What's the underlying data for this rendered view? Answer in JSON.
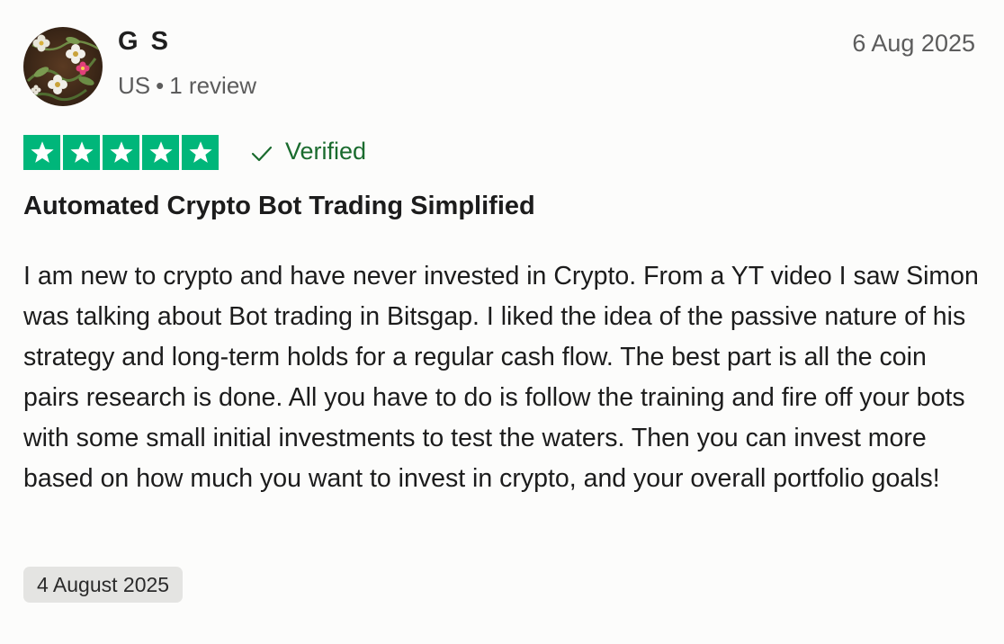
{
  "reviewer": {
    "name": "G S",
    "country": "US",
    "separator": "•",
    "review_count": "1 review"
  },
  "review": {
    "date": "6 Aug 2025",
    "rating": 5,
    "verified_label": "Verified",
    "title": "Automated Crypto Bot Trading Simplified",
    "body": "I am new to crypto and have never invested in Crypto. From a YT video I saw Simon was talking about Bot trading in Bitsgap. I liked the idea of the passive nature of his strategy and long-term holds for a regular cash flow. The best part is all the coin pairs research is done. All you have to do is follow the training and fire off your bots with some small initial investments to test the waters. Then you can invest more based on how much you want to invest in crypto, and your overall portfolio goals!",
    "experience_date": "4 August 2025"
  },
  "colors": {
    "star_green": "#00b67a",
    "verified_green": "#1a6b2e"
  },
  "icons": {
    "star": "star-icon",
    "verified": "checkmark-icon",
    "avatar": "avatar-image"
  }
}
